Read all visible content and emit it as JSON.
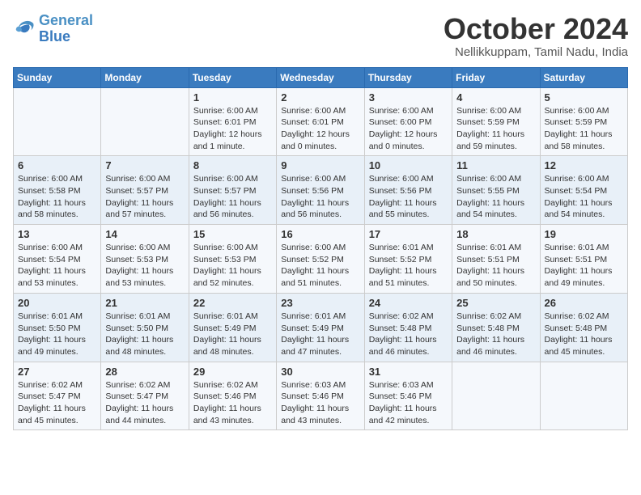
{
  "logo": {
    "line1": "General",
    "line2": "Blue"
  },
  "title": "October 2024",
  "location": "Nellikkuppam, Tamil Nadu, India",
  "columns": [
    "Sunday",
    "Monday",
    "Tuesday",
    "Wednesday",
    "Thursday",
    "Friday",
    "Saturday"
  ],
  "weeks": [
    [
      {
        "day": "",
        "info": ""
      },
      {
        "day": "",
        "info": ""
      },
      {
        "day": "1",
        "info": "Sunrise: 6:00 AM\nSunset: 6:01 PM\nDaylight: 12 hours and 1 minute."
      },
      {
        "day": "2",
        "info": "Sunrise: 6:00 AM\nSunset: 6:01 PM\nDaylight: 12 hours and 0 minutes."
      },
      {
        "day": "3",
        "info": "Sunrise: 6:00 AM\nSunset: 6:00 PM\nDaylight: 12 hours and 0 minutes."
      },
      {
        "day": "4",
        "info": "Sunrise: 6:00 AM\nSunset: 5:59 PM\nDaylight: 11 hours and 59 minutes."
      },
      {
        "day": "5",
        "info": "Sunrise: 6:00 AM\nSunset: 5:59 PM\nDaylight: 11 hours and 58 minutes."
      }
    ],
    [
      {
        "day": "6",
        "info": "Sunrise: 6:00 AM\nSunset: 5:58 PM\nDaylight: 11 hours and 58 minutes."
      },
      {
        "day": "7",
        "info": "Sunrise: 6:00 AM\nSunset: 5:57 PM\nDaylight: 11 hours and 57 minutes."
      },
      {
        "day": "8",
        "info": "Sunrise: 6:00 AM\nSunset: 5:57 PM\nDaylight: 11 hours and 56 minutes."
      },
      {
        "day": "9",
        "info": "Sunrise: 6:00 AM\nSunset: 5:56 PM\nDaylight: 11 hours and 56 minutes."
      },
      {
        "day": "10",
        "info": "Sunrise: 6:00 AM\nSunset: 5:56 PM\nDaylight: 11 hours and 55 minutes."
      },
      {
        "day": "11",
        "info": "Sunrise: 6:00 AM\nSunset: 5:55 PM\nDaylight: 11 hours and 54 minutes."
      },
      {
        "day": "12",
        "info": "Sunrise: 6:00 AM\nSunset: 5:54 PM\nDaylight: 11 hours and 54 minutes."
      }
    ],
    [
      {
        "day": "13",
        "info": "Sunrise: 6:00 AM\nSunset: 5:54 PM\nDaylight: 11 hours and 53 minutes."
      },
      {
        "day": "14",
        "info": "Sunrise: 6:00 AM\nSunset: 5:53 PM\nDaylight: 11 hours and 53 minutes."
      },
      {
        "day": "15",
        "info": "Sunrise: 6:00 AM\nSunset: 5:53 PM\nDaylight: 11 hours and 52 minutes."
      },
      {
        "day": "16",
        "info": "Sunrise: 6:00 AM\nSunset: 5:52 PM\nDaylight: 11 hours and 51 minutes."
      },
      {
        "day": "17",
        "info": "Sunrise: 6:01 AM\nSunset: 5:52 PM\nDaylight: 11 hours and 51 minutes."
      },
      {
        "day": "18",
        "info": "Sunrise: 6:01 AM\nSunset: 5:51 PM\nDaylight: 11 hours and 50 minutes."
      },
      {
        "day": "19",
        "info": "Sunrise: 6:01 AM\nSunset: 5:51 PM\nDaylight: 11 hours and 49 minutes."
      }
    ],
    [
      {
        "day": "20",
        "info": "Sunrise: 6:01 AM\nSunset: 5:50 PM\nDaylight: 11 hours and 49 minutes."
      },
      {
        "day": "21",
        "info": "Sunrise: 6:01 AM\nSunset: 5:50 PM\nDaylight: 11 hours and 48 minutes."
      },
      {
        "day": "22",
        "info": "Sunrise: 6:01 AM\nSunset: 5:49 PM\nDaylight: 11 hours and 48 minutes."
      },
      {
        "day": "23",
        "info": "Sunrise: 6:01 AM\nSunset: 5:49 PM\nDaylight: 11 hours and 47 minutes."
      },
      {
        "day": "24",
        "info": "Sunrise: 6:02 AM\nSunset: 5:48 PM\nDaylight: 11 hours and 46 minutes."
      },
      {
        "day": "25",
        "info": "Sunrise: 6:02 AM\nSunset: 5:48 PM\nDaylight: 11 hours and 46 minutes."
      },
      {
        "day": "26",
        "info": "Sunrise: 6:02 AM\nSunset: 5:48 PM\nDaylight: 11 hours and 45 minutes."
      }
    ],
    [
      {
        "day": "27",
        "info": "Sunrise: 6:02 AM\nSunset: 5:47 PM\nDaylight: 11 hours and 45 minutes."
      },
      {
        "day": "28",
        "info": "Sunrise: 6:02 AM\nSunset: 5:47 PM\nDaylight: 11 hours and 44 minutes."
      },
      {
        "day": "29",
        "info": "Sunrise: 6:02 AM\nSunset: 5:46 PM\nDaylight: 11 hours and 43 minutes."
      },
      {
        "day": "30",
        "info": "Sunrise: 6:03 AM\nSunset: 5:46 PM\nDaylight: 11 hours and 43 minutes."
      },
      {
        "day": "31",
        "info": "Sunrise: 6:03 AM\nSunset: 5:46 PM\nDaylight: 11 hours and 42 minutes."
      },
      {
        "day": "",
        "info": ""
      },
      {
        "day": "",
        "info": ""
      }
    ]
  ]
}
